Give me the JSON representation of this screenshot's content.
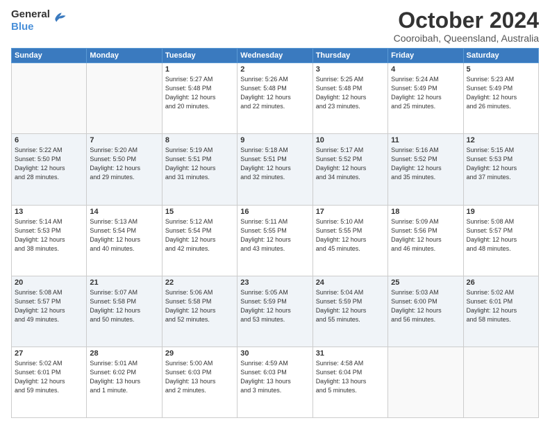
{
  "logo": {
    "general": "General",
    "blue": "Blue"
  },
  "title": {
    "month": "October 2024",
    "location": "Cooroibah, Queensland, Australia"
  },
  "weekdays": [
    "Sunday",
    "Monday",
    "Tuesday",
    "Wednesday",
    "Thursday",
    "Friday",
    "Saturday"
  ],
  "weeks": [
    [
      {
        "day": "",
        "info": ""
      },
      {
        "day": "",
        "info": ""
      },
      {
        "day": "1",
        "info": "Sunrise: 5:27 AM\nSunset: 5:48 PM\nDaylight: 12 hours\nand 20 minutes."
      },
      {
        "day": "2",
        "info": "Sunrise: 5:26 AM\nSunset: 5:48 PM\nDaylight: 12 hours\nand 22 minutes."
      },
      {
        "day": "3",
        "info": "Sunrise: 5:25 AM\nSunset: 5:48 PM\nDaylight: 12 hours\nand 23 minutes."
      },
      {
        "day": "4",
        "info": "Sunrise: 5:24 AM\nSunset: 5:49 PM\nDaylight: 12 hours\nand 25 minutes."
      },
      {
        "day": "5",
        "info": "Sunrise: 5:23 AM\nSunset: 5:49 PM\nDaylight: 12 hours\nand 26 minutes."
      }
    ],
    [
      {
        "day": "6",
        "info": "Sunrise: 5:22 AM\nSunset: 5:50 PM\nDaylight: 12 hours\nand 28 minutes."
      },
      {
        "day": "7",
        "info": "Sunrise: 5:20 AM\nSunset: 5:50 PM\nDaylight: 12 hours\nand 29 minutes."
      },
      {
        "day": "8",
        "info": "Sunrise: 5:19 AM\nSunset: 5:51 PM\nDaylight: 12 hours\nand 31 minutes."
      },
      {
        "day": "9",
        "info": "Sunrise: 5:18 AM\nSunset: 5:51 PM\nDaylight: 12 hours\nand 32 minutes."
      },
      {
        "day": "10",
        "info": "Sunrise: 5:17 AM\nSunset: 5:52 PM\nDaylight: 12 hours\nand 34 minutes."
      },
      {
        "day": "11",
        "info": "Sunrise: 5:16 AM\nSunset: 5:52 PM\nDaylight: 12 hours\nand 35 minutes."
      },
      {
        "day": "12",
        "info": "Sunrise: 5:15 AM\nSunset: 5:53 PM\nDaylight: 12 hours\nand 37 minutes."
      }
    ],
    [
      {
        "day": "13",
        "info": "Sunrise: 5:14 AM\nSunset: 5:53 PM\nDaylight: 12 hours\nand 38 minutes."
      },
      {
        "day": "14",
        "info": "Sunrise: 5:13 AM\nSunset: 5:54 PM\nDaylight: 12 hours\nand 40 minutes."
      },
      {
        "day": "15",
        "info": "Sunrise: 5:12 AM\nSunset: 5:54 PM\nDaylight: 12 hours\nand 42 minutes."
      },
      {
        "day": "16",
        "info": "Sunrise: 5:11 AM\nSunset: 5:55 PM\nDaylight: 12 hours\nand 43 minutes."
      },
      {
        "day": "17",
        "info": "Sunrise: 5:10 AM\nSunset: 5:55 PM\nDaylight: 12 hours\nand 45 minutes."
      },
      {
        "day": "18",
        "info": "Sunrise: 5:09 AM\nSunset: 5:56 PM\nDaylight: 12 hours\nand 46 minutes."
      },
      {
        "day": "19",
        "info": "Sunrise: 5:08 AM\nSunset: 5:57 PM\nDaylight: 12 hours\nand 48 minutes."
      }
    ],
    [
      {
        "day": "20",
        "info": "Sunrise: 5:08 AM\nSunset: 5:57 PM\nDaylight: 12 hours\nand 49 minutes."
      },
      {
        "day": "21",
        "info": "Sunrise: 5:07 AM\nSunset: 5:58 PM\nDaylight: 12 hours\nand 50 minutes."
      },
      {
        "day": "22",
        "info": "Sunrise: 5:06 AM\nSunset: 5:58 PM\nDaylight: 12 hours\nand 52 minutes."
      },
      {
        "day": "23",
        "info": "Sunrise: 5:05 AM\nSunset: 5:59 PM\nDaylight: 12 hours\nand 53 minutes."
      },
      {
        "day": "24",
        "info": "Sunrise: 5:04 AM\nSunset: 5:59 PM\nDaylight: 12 hours\nand 55 minutes."
      },
      {
        "day": "25",
        "info": "Sunrise: 5:03 AM\nSunset: 6:00 PM\nDaylight: 12 hours\nand 56 minutes."
      },
      {
        "day": "26",
        "info": "Sunrise: 5:02 AM\nSunset: 6:01 PM\nDaylight: 12 hours\nand 58 minutes."
      }
    ],
    [
      {
        "day": "27",
        "info": "Sunrise: 5:02 AM\nSunset: 6:01 PM\nDaylight: 12 hours\nand 59 minutes."
      },
      {
        "day": "28",
        "info": "Sunrise: 5:01 AM\nSunset: 6:02 PM\nDaylight: 13 hours\nand 1 minute."
      },
      {
        "day": "29",
        "info": "Sunrise: 5:00 AM\nSunset: 6:03 PM\nDaylight: 13 hours\nand 2 minutes."
      },
      {
        "day": "30",
        "info": "Sunrise: 4:59 AM\nSunset: 6:03 PM\nDaylight: 13 hours\nand 3 minutes."
      },
      {
        "day": "31",
        "info": "Sunrise: 4:58 AM\nSunset: 6:04 PM\nDaylight: 13 hours\nand 5 minutes."
      },
      {
        "day": "",
        "info": ""
      },
      {
        "day": "",
        "info": ""
      }
    ]
  ]
}
